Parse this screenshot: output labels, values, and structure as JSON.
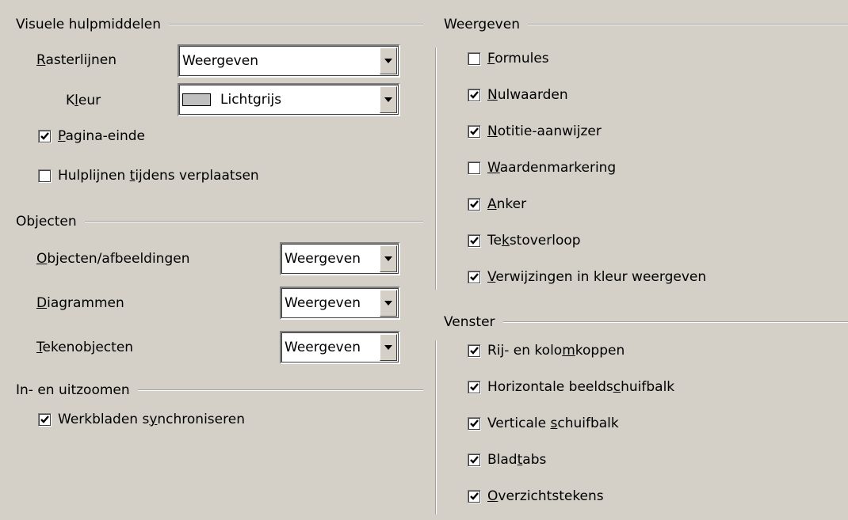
{
  "visual_aids": {
    "title": "Visuele hulpmiddelen",
    "gridlines_pre": "",
    "gridlines_u": "R",
    "gridlines_post": "asterlijnen",
    "gridlines_value": "Weergeven",
    "color_pre": "K",
    "color_u": "l",
    "color_post": "eur",
    "color_value": "Lichtgrijs",
    "page_breaks": {
      "pre": "",
      "u": "P",
      "post": "agina-einde",
      "checked": true
    },
    "helplines": {
      "pre": "Hulplijnen ",
      "u": "t",
      "post": "ijdens verplaatsen",
      "checked": false
    }
  },
  "objects": {
    "title": "Objecten",
    "rows": [
      {
        "pre": "",
        "u": "O",
        "post": "bjecten/afbeeldingen",
        "value": "Weergeven"
      },
      {
        "pre": "",
        "u": "D",
        "post": "iagrammen",
        "value": "Weergeven"
      },
      {
        "pre": "",
        "u": "T",
        "post": "ekenobjecten",
        "value": "Weergeven"
      }
    ]
  },
  "zoom": {
    "title": "In- en uitzoomen",
    "sync": {
      "pre": "Werkbladen s",
      "u": "y",
      "post": "nchroniseren",
      "checked": true
    }
  },
  "display": {
    "title": "Weergeven",
    "items": [
      {
        "pre": "",
        "u": "F",
        "post": "ormules",
        "checked": false
      },
      {
        "pre": "",
        "u": "N",
        "post": "ulwaarden",
        "checked": true
      },
      {
        "pre": "",
        "u": "N",
        "post": "otitie-aanwijzer",
        "checked": true
      },
      {
        "pre": "",
        "u": "W",
        "post": "aardenmarkering",
        "checked": false
      },
      {
        "pre": "",
        "u": "A",
        "post": "nker",
        "checked": true
      },
      {
        "pre": "Te",
        "u": "k",
        "post": "stoverloop",
        "checked": true
      },
      {
        "pre": "",
        "u": "V",
        "post": "erwijzingen in kleur weergeven",
        "checked": true
      }
    ]
  },
  "window": {
    "title": "Venster",
    "items": [
      {
        "pre": "Rij- en kolo",
        "u": "m",
        "post": "koppen",
        "checked": true
      },
      {
        "pre": "Horizontale beelds",
        "u": "c",
        "post": "huifbalk",
        "checked": true
      },
      {
        "pre": "Verticale ",
        "u": "s",
        "post": "chuifbalk",
        "checked": true
      },
      {
        "pre": "Blad",
        "u": "t",
        "post": "abs",
        "checked": true
      },
      {
        "pre": "",
        "u": "O",
        "post": "verzichtstekens",
        "checked": true
      }
    ]
  },
  "icons": {
    "checkmark": "check-icon",
    "dropdown": "chevron-down-icon"
  }
}
